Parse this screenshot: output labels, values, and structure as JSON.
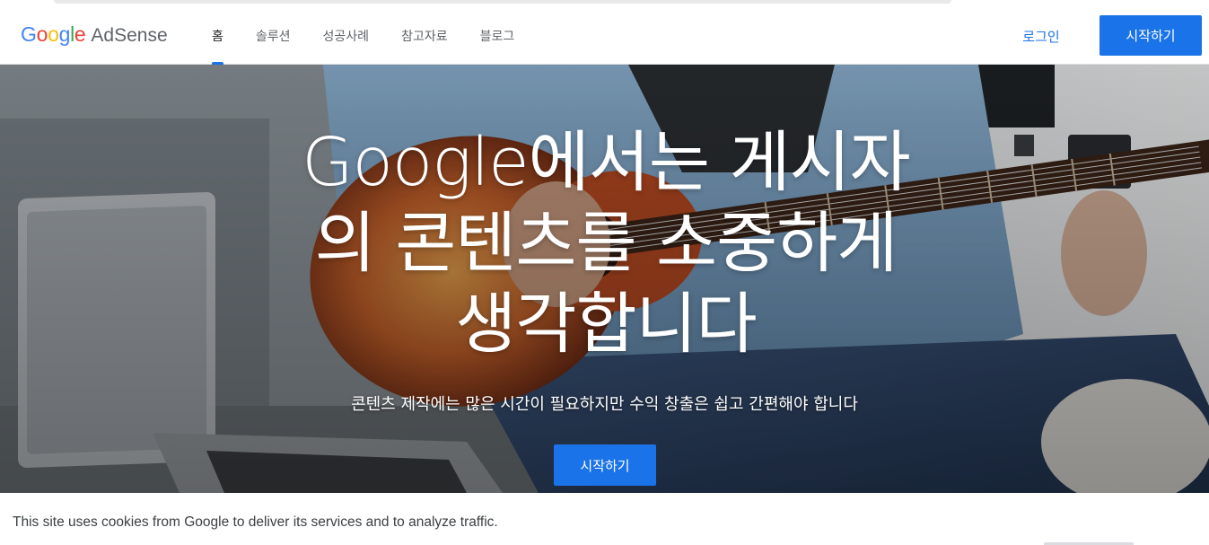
{
  "brand": {
    "google_letters": [
      "G",
      "o",
      "o",
      "g",
      "l",
      "e"
    ],
    "product": "AdSense"
  },
  "nav": {
    "items": [
      {
        "label": "홈",
        "active": true
      },
      {
        "label": "솔루션",
        "active": false
      },
      {
        "label": "성공사례",
        "active": false
      },
      {
        "label": "참고자료",
        "active": false
      },
      {
        "label": "블로그",
        "active": false
      }
    ],
    "login_label": "로그인",
    "start_label": "시작하기"
  },
  "hero": {
    "title_lines": [
      "Google에서는 게시자",
      "의 콘텐츠를 소중하게",
      "생각합니다"
    ],
    "subtitle": "콘텐츠 제작에는 많은 시간이 필요하지만 수익 창출은 쉽고 간편해야 합니다",
    "cta_label": "시작하기"
  },
  "cookie_banner": {
    "text": "This site uses cookies from Google to deliver its services and to analyze traffic."
  },
  "colors": {
    "accent": "#1a73e8",
    "google_blue": "#4285f4",
    "google_red": "#ea4335",
    "google_yellow": "#fbbc05",
    "google_green": "#34a853"
  }
}
